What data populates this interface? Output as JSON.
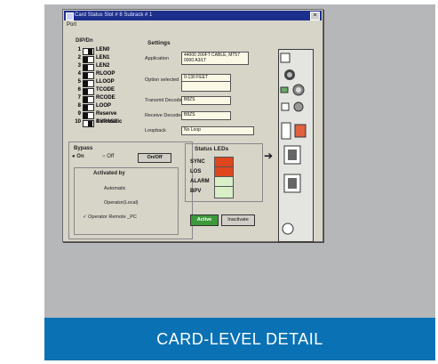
{
  "banner": {
    "text": "CARD-LEVEL DETAIL"
  },
  "window": {
    "title": "Card Status Slot # 8 Subrack # 1",
    "menu": "Port",
    "close_glyph": "×"
  },
  "dip": {
    "heading": "DIP/Dn",
    "rows": [
      {
        "num": "1",
        "label": "LEN0",
        "on": true
      },
      {
        "num": "2",
        "label": "LEN1",
        "on": false
      },
      {
        "num": "3",
        "label": "LEN2",
        "on": false
      },
      {
        "num": "4",
        "label": "RLOOP",
        "on": false
      },
      {
        "num": "5",
        "label": "LLOOP",
        "on": false
      },
      {
        "num": "6",
        "label": "TCODE",
        "on": false
      },
      {
        "num": "7",
        "label": "RCODE",
        "on": false
      },
      {
        "num": "8",
        "label": "LOOP",
        "on": false
      },
      {
        "num": "9",
        "label": "Reserve",
        "on": false
      },
      {
        "num": "10",
        "label": "Automatic",
        "on": true
      }
    ],
    "extra": "BYPASS"
  },
  "settings": {
    "heading": "Settings",
    "application_label": "Application",
    "application_value": "44000 200FT CABLE, MT57 0000 A3/LT",
    "option_label": "Option selected",
    "option_value": "0-130 FEET",
    "transmit_label": "Transmit Decoder",
    "transmit_value": "B8ZS",
    "receive_label": "Receive Decoder",
    "receive_value": "B8ZS",
    "loopback_label": "Loopback",
    "loopback_value": "No Loop"
  },
  "bypass": {
    "heading": "Bypass",
    "on_label": "On",
    "off_label": "Off",
    "button_label": "On/Off",
    "activated_heading": "Activated by",
    "opt1": "Automatic",
    "opt2": "Operator(Local)",
    "opt3": "Operator Remote _PC",
    "check": "✓"
  },
  "status": {
    "heading": "Status LEDs",
    "leds": [
      {
        "label": "SYNC",
        "color": "#e0461e"
      },
      {
        "label": "LOS",
        "color": "#e0461e"
      },
      {
        "label": "ALARM",
        "color": "#d8efc8"
      },
      {
        "label": "BPV",
        "color": "#d8efc8"
      }
    ],
    "active_label": "Active",
    "inactivate_label": "Inactivate"
  },
  "colors": {
    "banner": "#0a72b4",
    "frame": "#b6b7b9",
    "window": "#d7d4c8",
    "titlebar": "#1d2f8c",
    "led_red": "#e0461e",
    "led_green": "#d8efc8",
    "active_button": "#3c9a3a"
  },
  "arrow": "➔"
}
